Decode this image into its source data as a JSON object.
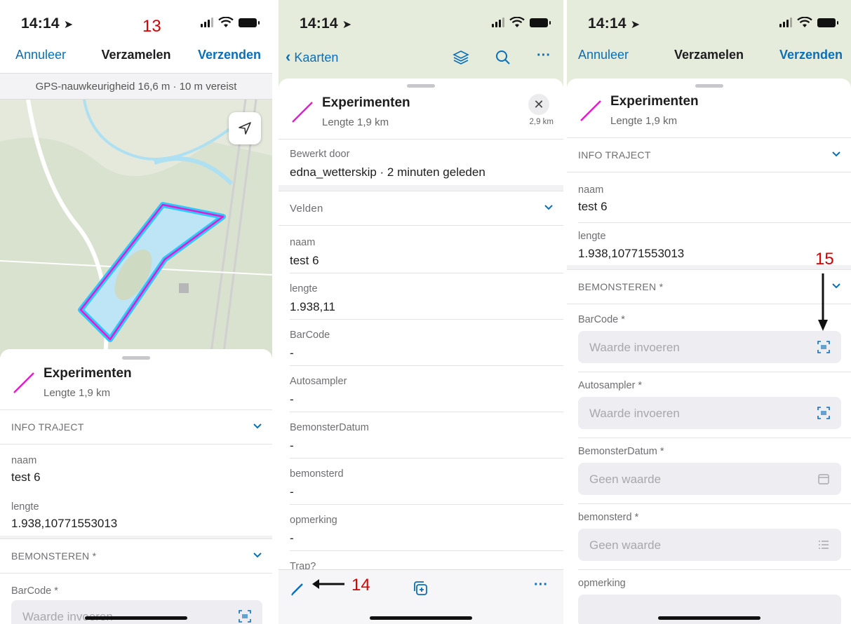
{
  "annotations": {
    "s1": "13",
    "s2": "14",
    "s3": "15"
  },
  "screen1": {
    "time": "14:14",
    "nav": {
      "left": "Annuleer",
      "title": "Verzamelen",
      "right": "Verzenden"
    },
    "gps": "GPS-nauwkeurigheid 16,6 m · 10 m vereist",
    "feature": {
      "title": "Experimenten",
      "subtitle": "Lengte 1,9 km"
    },
    "section1": "INFO TRAJECT",
    "naam_label": "naam",
    "naam_value": "test 6",
    "lengte_label": "lengte",
    "lengte_value": "1.938,10771553013",
    "section2": "BEMONSTEREN *",
    "barcode_label": "BarCode *",
    "barcode_placeholder": "Waarde invoeren"
  },
  "screen2": {
    "time": "14:14",
    "nav": {
      "back": "Kaarten"
    },
    "feature": {
      "title": "Experimenten",
      "subtitle": "Lengte 1,9 km",
      "distance": "2,9 km"
    },
    "edited_label": "Bewerkt door",
    "edited_value": "edna_wetterskip · 2 minuten geleden",
    "section": "Velden",
    "fields": [
      {
        "label": "naam",
        "value": "test 6"
      },
      {
        "label": "lengte",
        "value": "1.938,11"
      },
      {
        "label": "BarCode",
        "value": "-"
      },
      {
        "label": "Autosampler",
        "value": "-"
      },
      {
        "label": "BemonsterDatum",
        "value": "-"
      },
      {
        "label": "bemonsterd",
        "value": "-"
      },
      {
        "label": "opmerking",
        "value": "-"
      },
      {
        "label": "Trap?",
        "value": ""
      }
    ]
  },
  "screen3": {
    "time": "14:14",
    "nav": {
      "left": "Annuleer",
      "title": "Verzamelen",
      "right": "Verzenden"
    },
    "feature": {
      "title": "Experimenten",
      "subtitle": "Lengte 1,9 km"
    },
    "section1": "INFO TRAJECT",
    "naam_label": "naam",
    "naam_value": "test 6",
    "lengte_label": "lengte",
    "lengte_value": "1.938,10771553013",
    "section2": "BEMONSTEREN *",
    "inputs": [
      {
        "label": "BarCode *",
        "placeholder": "Waarde invoeren",
        "icon": "barcode-scan-icon"
      },
      {
        "label": "Autosampler *",
        "placeholder": "Waarde invoeren",
        "icon": "barcode-scan-icon"
      },
      {
        "label": "BemonsterDatum *",
        "placeholder": "Geen waarde",
        "icon": "calendar-icon"
      },
      {
        "label": "bemonsterd *",
        "placeholder": "Geen waarde",
        "icon": "list-icon"
      },
      {
        "label": "opmerking",
        "placeholder": "",
        "icon": ""
      }
    ]
  },
  "colors": {
    "accent": "#0a6fb8",
    "annotation": "#d90000",
    "feature_line": "#e41ccf"
  }
}
